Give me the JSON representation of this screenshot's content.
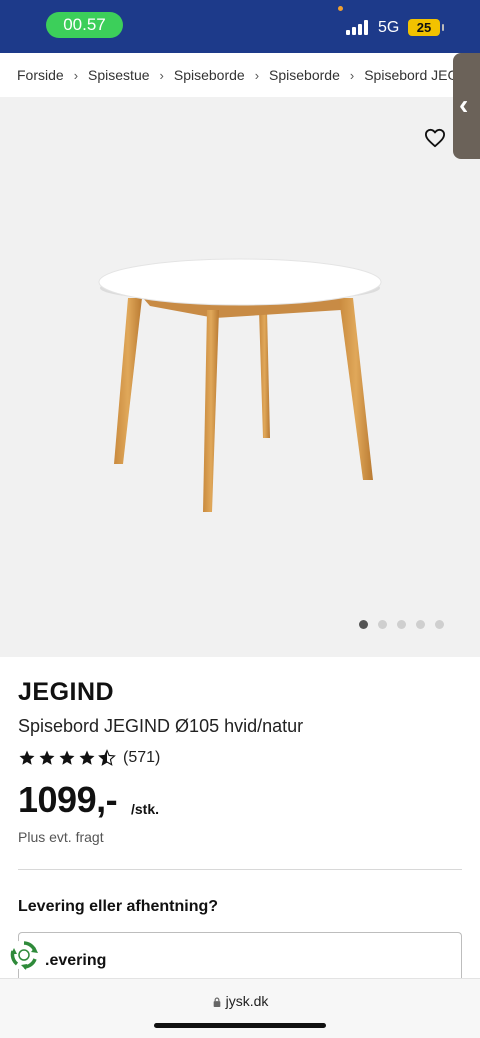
{
  "status_bar": {
    "time": "00.57",
    "network": "5G",
    "battery": "25"
  },
  "breadcrumb": [
    "Forside",
    "Spisestue",
    "Spiseborde",
    "Spiseborde",
    "Spisebord JEGI"
  ],
  "gallery": {
    "slide_count": 5,
    "active_slide": 1
  },
  "product": {
    "brand": "JEGIND",
    "name": "Spisebord JEGIND Ø105 hvid/natur",
    "rating": 4.5,
    "rating_count": "(571)",
    "price": "1099,-",
    "unit": "/stk.",
    "freight_note": "Plus evt. fragt"
  },
  "delivery": {
    "heading": "Levering eller afhentning?",
    "option_label": ".evering"
  },
  "browser": {
    "url": "jysk.dk"
  },
  "icons": {
    "favorite": "heart-outline-icon",
    "side_tab": "chevron-left-icon",
    "recycle": "recycle-icon",
    "lock": "lock-icon"
  }
}
